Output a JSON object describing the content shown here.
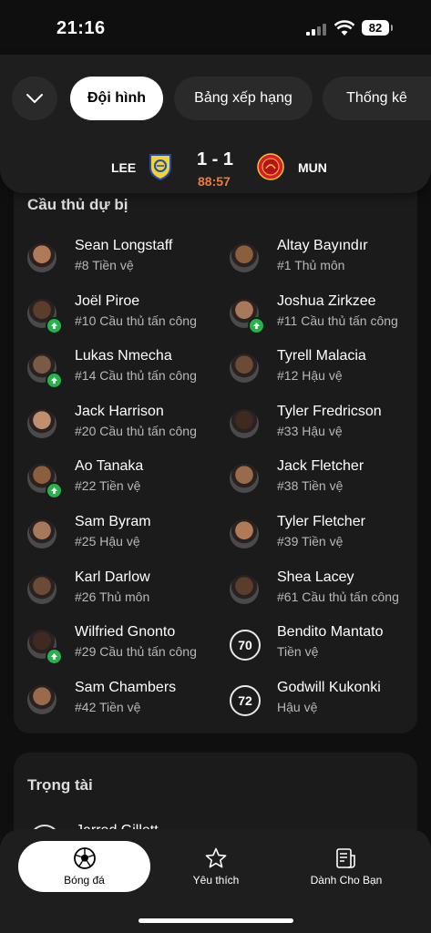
{
  "status_bar": {
    "time": "21:16",
    "battery": "82"
  },
  "header": {
    "tabs": [
      {
        "label": "Đội hình",
        "active": true
      },
      {
        "label": "Bảng xếp hạng",
        "active": false
      },
      {
        "label": "Thống kê",
        "active": false
      }
    ],
    "match": {
      "home_code": "LEE",
      "away_code": "MUN",
      "score": "1 - 1",
      "minute": "88:57"
    }
  },
  "substitutes": {
    "title": "Cầu thủ dự bị",
    "left": [
      {
        "name": "Sean Longstaff",
        "info": "#8 Tiền vệ",
        "subbed_in": false
      },
      {
        "name": "Joël Piroe",
        "info": "#10 Cầu thủ tấn công",
        "subbed_in": true
      },
      {
        "name": "Lukas Nmecha",
        "info": "#14 Cầu thủ tấn công",
        "subbed_in": true
      },
      {
        "name": "Jack Harrison",
        "info": "#20 Cầu thủ tấn công",
        "subbed_in": false
      },
      {
        "name": "Ao Tanaka",
        "info": "#22 Tiền vệ",
        "subbed_in": true
      },
      {
        "name": "Sam Byram",
        "info": "#25 Hậu vệ",
        "subbed_in": false
      },
      {
        "name": "Karl Darlow",
        "info": "#26 Thủ môn",
        "subbed_in": false
      },
      {
        "name": "Wilfried Gnonto",
        "info": "#29 Cầu thủ tấn công",
        "subbed_in": true
      },
      {
        "name": "Sam Chambers",
        "info": "#42 Tiền vệ",
        "subbed_in": false
      }
    ],
    "right": [
      {
        "name": "Altay Bayındır",
        "info": "#1 Thủ môn",
        "subbed_in": false
      },
      {
        "name": "Joshua Zirkzee",
        "info": "#11 Cầu thủ tấn công",
        "subbed_in": true
      },
      {
        "name": "Tyrell Malacia",
        "info": "#12 Hậu vệ",
        "subbed_in": false
      },
      {
        "name": "Tyler Fredricson",
        "info": "#33 Hậu vệ",
        "subbed_in": false
      },
      {
        "name": "Jack Fletcher",
        "info": "#38 Tiền vệ",
        "subbed_in": false
      },
      {
        "name": "Tyler Fletcher",
        "info": "#39 Tiền vệ",
        "subbed_in": false
      },
      {
        "name": "Shea Lacey",
        "info": "#61 Cầu thủ tấn công",
        "subbed_in": false
      },
      {
        "name": "Bendito Mantato",
        "info": "Tiền vệ",
        "number": "70"
      },
      {
        "name": "Godwill Kukonki",
        "info": "Hậu vệ",
        "number": "72"
      }
    ]
  },
  "referee": {
    "title": "Trọng tài",
    "name": "Jarred Gillett"
  },
  "bottom_nav": [
    {
      "label": "Bóng đá",
      "icon": "soccer-ball-icon",
      "active": true
    },
    {
      "label": "Yêu thích",
      "icon": "star-icon",
      "active": false
    },
    {
      "label": "Dành Cho Bạn",
      "icon": "news-icon",
      "active": false
    }
  ],
  "colors": {
    "accent_minute": "#f07a3a",
    "sub_in_green": "#28b24b",
    "background": "#0f0f0f",
    "card": "#1b1b1b"
  }
}
